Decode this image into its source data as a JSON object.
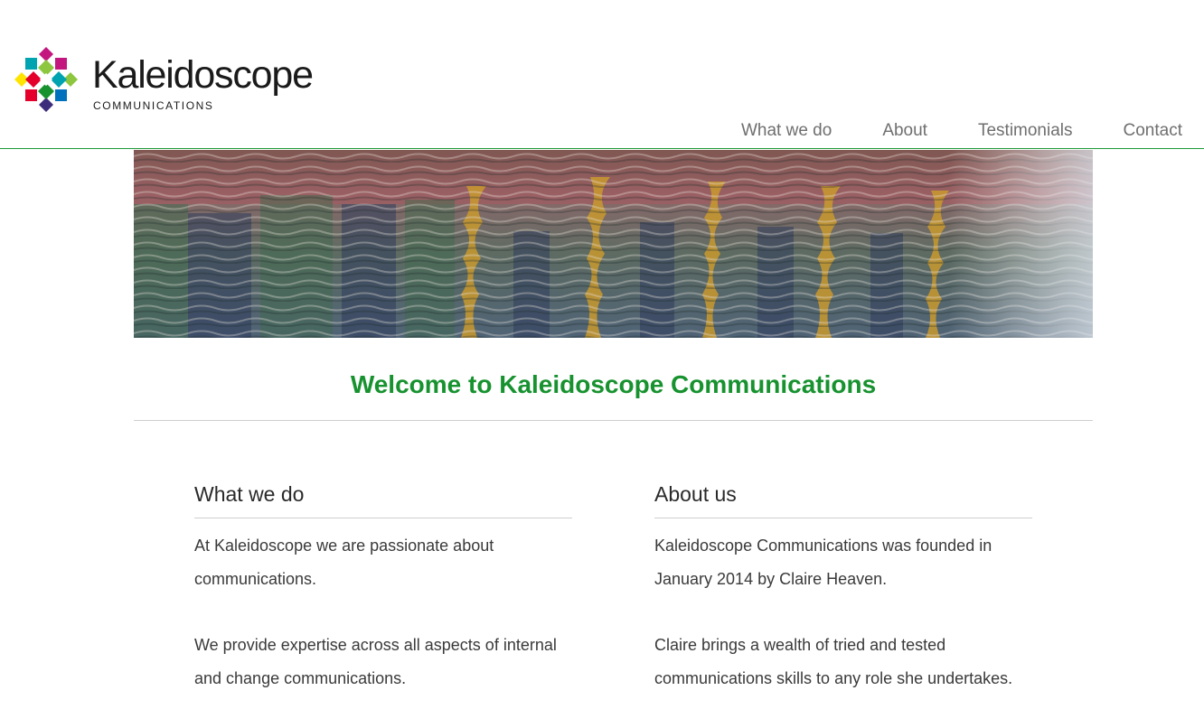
{
  "brand": {
    "name": "Kaleidoscope",
    "tagline": "COMMUNICATIONS",
    "colors": {
      "green": "#17922f",
      "magenta": "#c3177f",
      "teal": "#00a3b0",
      "lime": "#8dc63f",
      "yellow": "#ffe400",
      "red": "#e4002b",
      "blue": "#0071bc",
      "purple": "#3d2e7c"
    }
  },
  "nav": {
    "items": [
      {
        "label": "What we do"
      },
      {
        "label": "About"
      },
      {
        "label": "Testimonials"
      },
      {
        "label": "Contact"
      }
    ]
  },
  "hero": {
    "image": "water-reflection-photo"
  },
  "welcome": {
    "title": "Welcome to Kaleidoscope Communications"
  },
  "sections": {
    "what_we_do": {
      "heading": "What we do",
      "paragraphs": [
        "At Kaleidoscope we are passionate about communications.",
        "We provide expertise across all aspects of internal and change communications."
      ]
    },
    "about_us": {
      "heading": "About us",
      "paragraphs": [
        "Kaleidoscope Communications was founded in January 2014 by Claire Heaven.",
        "Claire brings a wealth of tried and tested communications skills to any role she undertakes."
      ]
    }
  }
}
